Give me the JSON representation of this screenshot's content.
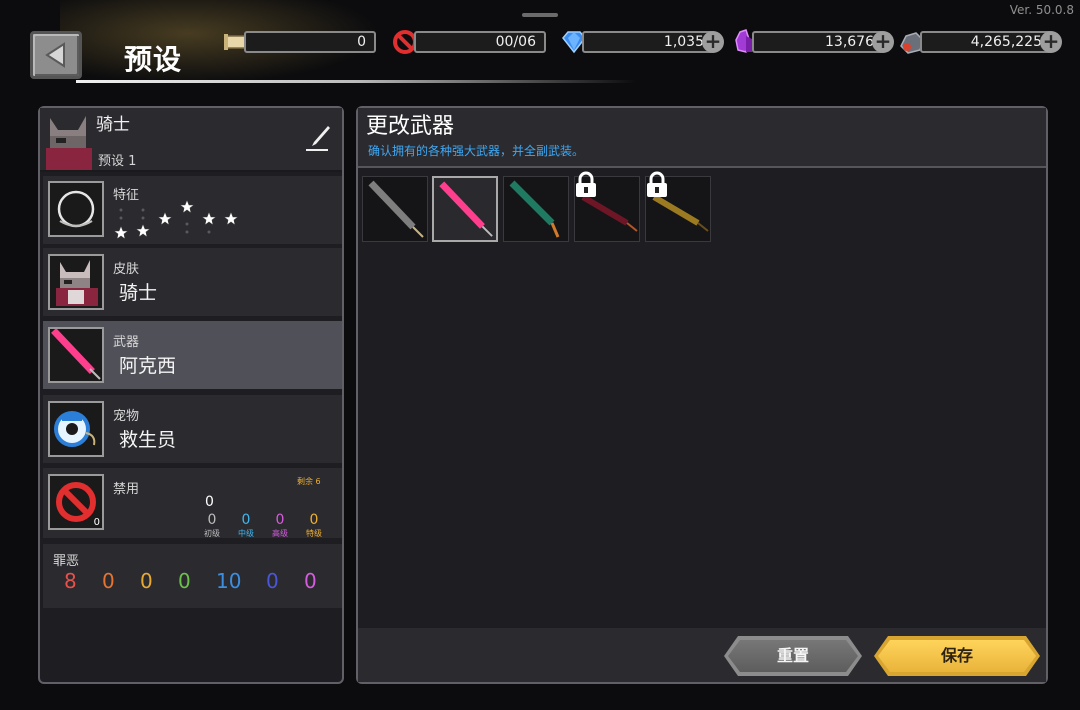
{
  "version": "Ver. 50.0.8",
  "header": {
    "title": "预设"
  },
  "resources": [
    {
      "icon": "scroll-icon",
      "value": "0"
    },
    {
      "icon": "ban-icon",
      "value": "00/06"
    },
    {
      "icon": "blue-gem-icon",
      "value": "1,035"
    },
    {
      "icon": "purple-crystal-icon",
      "value": "13,676"
    },
    {
      "icon": "ore-icon",
      "value": "4,265,225"
    }
  ],
  "character": {
    "name": "骑士",
    "preset": "预设 1"
  },
  "traits": {
    "label": "特征"
  },
  "skin": {
    "label": "皮肤",
    "value": "骑士"
  },
  "weapon": {
    "label": "武器",
    "value": "阿克西"
  },
  "pet": {
    "label": "宠物",
    "value": "救生员"
  },
  "ban": {
    "label": "禁用",
    "count": "0",
    "remaining": "剩余 6",
    "total": "0",
    "levels": [
      {
        "value": "0",
        "label": "初级",
        "color": "#bdbdbd"
      },
      {
        "value": "0",
        "label": "中级",
        "color": "#3fb7f0"
      },
      {
        "value": "0",
        "label": "高级",
        "color": "#d75ce0"
      },
      {
        "value": "0",
        "label": "特级",
        "color": "#f0b030"
      }
    ]
  },
  "sins": {
    "label": "罪恶",
    "values": [
      {
        "value": "8",
        "color": "#e8504a"
      },
      {
        "value": "0",
        "color": "#e8732e"
      },
      {
        "value": "0",
        "color": "#e8a930"
      },
      {
        "value": "0",
        "color": "#6cc14a"
      },
      {
        "value": "10",
        "color": "#3c8fe0"
      },
      {
        "value": "0",
        "color": "#4a56d8"
      },
      {
        "value": "0",
        "color": "#d55be0"
      }
    ]
  },
  "main": {
    "title": "更改武器",
    "subtitle": "确认拥有的各种强大武器，并全副武装。",
    "weapons": [
      {
        "name": "grey-sword",
        "color": "#8a8a8a",
        "locked": false,
        "selected": false
      },
      {
        "name": "pink-sword",
        "color": "#ff3f8e",
        "locked": false,
        "selected": true
      },
      {
        "name": "teal-sword",
        "color": "#1f7a62",
        "locked": false,
        "selected": false
      },
      {
        "name": "dark-red-sword",
        "color": "#8a1a2e",
        "locked": true,
        "selected": false
      },
      {
        "name": "gold-sword",
        "color": "#b08a2a",
        "locked": true,
        "selected": false
      }
    ]
  },
  "buttons": {
    "reset": "重置",
    "save": "保存"
  }
}
